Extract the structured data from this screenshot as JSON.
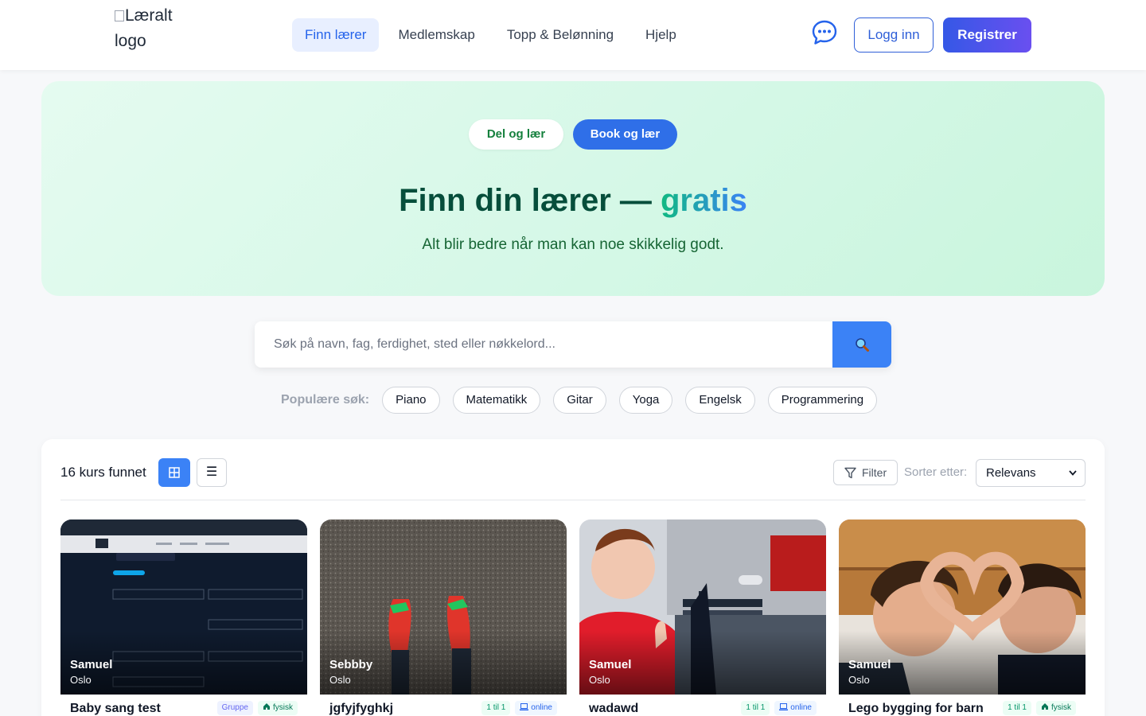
{
  "header": {
    "logo_alt": "Læralt logo",
    "nav": [
      {
        "label": "Finn lærer",
        "active": true
      },
      {
        "label": "Medlemskap",
        "active": false
      },
      {
        "label": "Topp & Belønning",
        "active": false
      },
      {
        "label": "Hjelp",
        "active": false
      }
    ],
    "chat_icon": "chat-bubble-icon",
    "login_label": "Logg inn",
    "register_label": "Registrer"
  },
  "hero": {
    "toggle_share": "Del og lær",
    "toggle_book": "Book og lær",
    "title_main": "Finn din lærer — ",
    "title_accent": "gratis",
    "subtitle": "Alt blir bedre når man kan noe skikkelig godt."
  },
  "search": {
    "placeholder": "Søk på navn, fag, ferdighet, sted eller nøkkelord...",
    "popular_label": "Populære søk:",
    "popular": [
      "Piano",
      "Matematikk",
      "Gitar",
      "Yoga",
      "Engelsk",
      "Programmering"
    ]
  },
  "results": {
    "count_text": "16 kurs funnet",
    "list_view_glyph": "☰",
    "filter_label": "Filter",
    "sort_label": "Sorter etter:",
    "sort_value": "Relevans",
    "cards": [
      {
        "name": "Samuel",
        "city": "Oslo",
        "title": "Baby sang test",
        "badges": [
          {
            "text": "Gruppe",
            "kind": "group"
          },
          {
            "text": "fysisk",
            "kind": "physical"
          }
        ]
      },
      {
        "name": "Sebbby",
        "city": "Oslo",
        "title": "jgfyjfyghkj",
        "badges": [
          {
            "text": "1 til 1",
            "kind": "one"
          },
          {
            "text": "online",
            "kind": "online"
          }
        ]
      },
      {
        "name": "Samuel",
        "city": "Oslo",
        "title": "wadawd",
        "badges": [
          {
            "text": "1 til 1",
            "kind": "one"
          },
          {
            "text": "online",
            "kind": "online"
          }
        ]
      },
      {
        "name": "Samuel",
        "city": "Oslo",
        "title": "Lego bygging for barn",
        "badges": [
          {
            "text": "1 til 1",
            "kind": "one"
          },
          {
            "text": "fysisk",
            "kind": "physical"
          }
        ]
      }
    ]
  },
  "colors": {
    "primary": "#2f6fe8",
    "hero_bg": "#d5f8e7",
    "hero_title": "#064e3b"
  }
}
